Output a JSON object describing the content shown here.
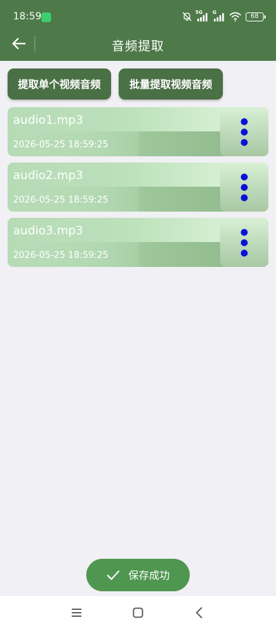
{
  "status_bar": {
    "time": "18:59",
    "battery": "68",
    "signal_1": "5G",
    "signal_2": "G",
    "icons": [
      "app-notification-icon",
      "mute-bell-icon",
      "signal-5g-icon",
      "signal-g-icon",
      "wifi-icon",
      "battery-icon"
    ]
  },
  "toolbar": {
    "title": "音频提取",
    "back_icon": "arrow-left-icon"
  },
  "actions": {
    "extract_single": "提取单个视频音频",
    "extract_batch": "批量提取视频音频"
  },
  "audio_files": [
    {
      "name": "audio1.mp3",
      "date": "2026-05-25 18:59:25"
    },
    {
      "name": "audio2.mp3",
      "date": "2026-05-25 18:59:25"
    },
    {
      "name": "audio3.mp3",
      "date": "2026-05-25 18:59:25"
    }
  ],
  "toast": {
    "message": "保存成功",
    "icon": "check-icon"
  },
  "nav_bar": {
    "icons": [
      "menu-icon",
      "home-icon",
      "back-icon"
    ]
  },
  "colors": {
    "primary": "#4e7a49",
    "button": "#4a7046",
    "toast": "#4f9650",
    "more_dots": "#0a12d6",
    "background": "#f1f0f4"
  }
}
